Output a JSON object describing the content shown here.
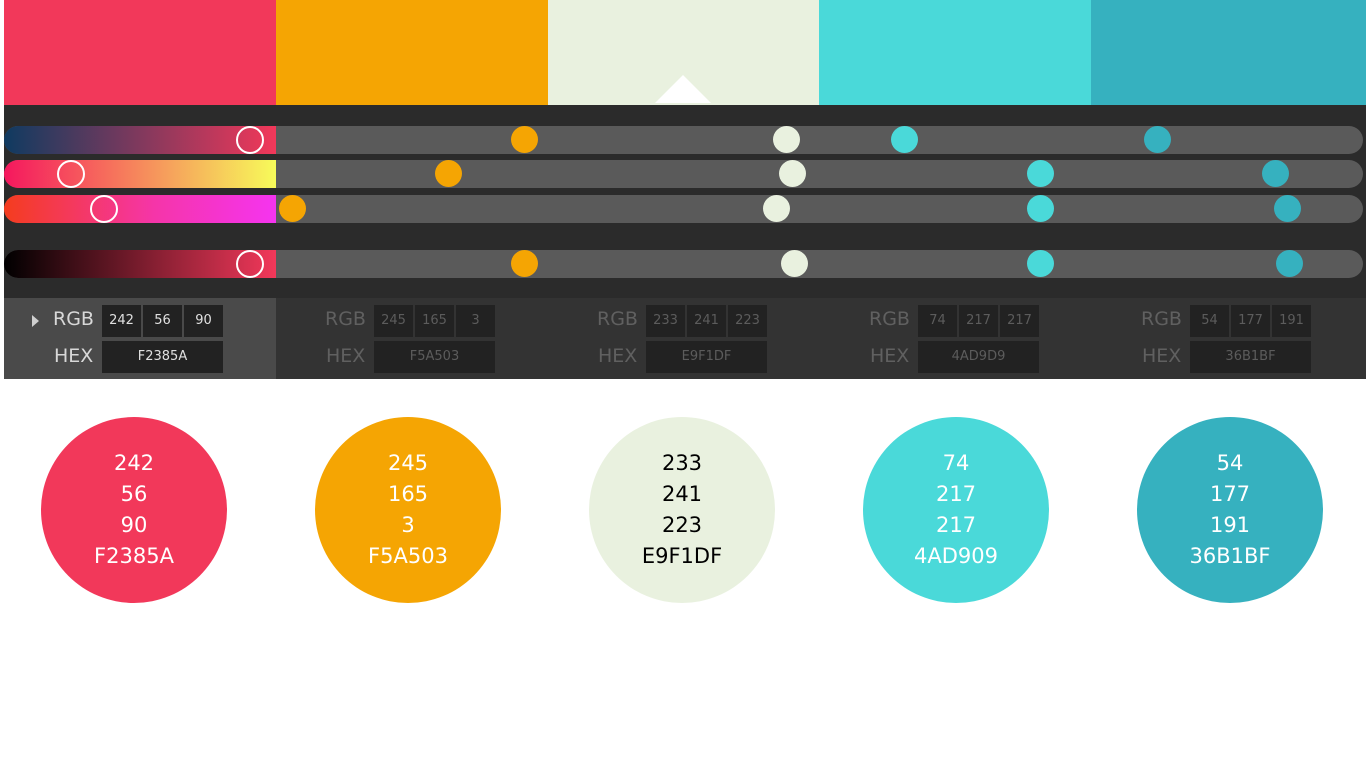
{
  "colors": {
    "c1": "#F2385A",
    "c2": "#F5A503",
    "c3": "#E9F1DF",
    "c4": "#4AD9D9",
    "c5": "#36B1BF"
  },
  "panel": {
    "rgb_label": "RGB",
    "hex_label": "HEX",
    "columns": [
      {
        "r": "242",
        "g": "56",
        "b": "90",
        "hex": "F2385A"
      },
      {
        "r": "245",
        "g": "165",
        "b": "3",
        "hex": "F5A503"
      },
      {
        "r": "233",
        "g": "241",
        "b": "223",
        "hex": "E9F1DF"
      },
      {
        "r": "74",
        "g": "217",
        "b": "217",
        "hex": "4AD9D9"
      },
      {
        "r": "54",
        "g": "177",
        "b": "191",
        "hex": "36B1BF"
      }
    ]
  },
  "circles": [
    {
      "r": "242",
      "g": "56",
      "b": "90",
      "hex": "F2385A",
      "color": "#F2385A",
      "text_color": "#ffffff"
    },
    {
      "r": "245",
      "g": "165",
      "b": "3",
      "hex": "F5A503",
      "color": "#F5A503",
      "text_color": "#ffffff"
    },
    {
      "r": "233",
      "g": "241",
      "b": "223",
      "hex": "E9F1DF",
      "color": "#E9F1DF",
      "text_color": "#000000"
    },
    {
      "r": "74",
      "g": "217",
      "b": "217",
      "hex": "4AD909",
      "color": "#4AD9D9",
      "text_color": "#ffffff"
    },
    {
      "r": "54",
      "g": "177",
      "b": "191",
      "hex": "36B1BF",
      "color": "#36B1BF",
      "text_color": "#ffffff"
    }
  ]
}
